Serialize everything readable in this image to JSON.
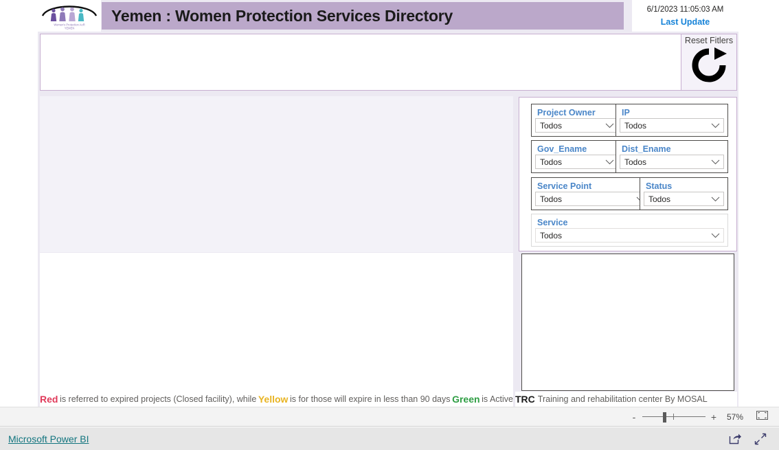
{
  "header": {
    "logo_alt": "Women's Protection AoR Yemen logo",
    "logo_caption_line1": "Women's Protection AoR",
    "logo_caption_line2": "YEMEN",
    "title": "Yemen : Women Protection Services Directory",
    "last_update_date": "6/1/2023 11:05:03 AM",
    "last_update_label": "Last Update",
    "title_bar_color": "#bba8ca",
    "last_update_color": "#1683d8"
  },
  "reset": {
    "label": "Reset Fitlers",
    "icon": "refresh-circular-arrow-icon"
  },
  "slicers": [
    {
      "id": "project-owner",
      "title": "Project Owner",
      "value": "Todos",
      "icon": "chevron-down-icon"
    },
    {
      "id": "ip",
      "title": "IP",
      "value": "Todos",
      "icon": "chevron-down-icon"
    },
    {
      "id": "gov-ename",
      "title": "Gov_Ename",
      "value": "Todos",
      "icon": "chevron-down-icon"
    },
    {
      "id": "dist-ename",
      "title": "Dist_Ename",
      "value": "Todos",
      "icon": "chevron-down-icon"
    },
    {
      "id": "service-point",
      "title": "Service Point",
      "value": "Todos",
      "icon": "chevron-down-icon"
    },
    {
      "id": "status",
      "title": "Status",
      "value": "Todos",
      "icon": "chevron-down-icon"
    },
    {
      "id": "service",
      "title": "Service",
      "value": "Todos",
      "icon": "chevron-down-icon"
    }
  ],
  "legend": {
    "red_word": "Red",
    "text_1": "is referred to expired projects (Closed facility), while",
    "yellow_word": "Yellow",
    "text_2": "is for those will expire in less than 90 days",
    "green_word": "Green",
    "text_3": "is Active",
    "red_color": "#e03a5a",
    "yellow_color": "#e8b423",
    "green_color": "#2f9e44",
    "trc_abbr": "TRC",
    "trc_text": "Training and rehabilitation center By MOSAL"
  },
  "status_bar": {
    "zoom_out_label": "-",
    "zoom_in_label": "+",
    "zoom_percent": "57%",
    "fit_icon": "fit-to-page-icon"
  },
  "footer": {
    "brand": "Microsoft Power BI",
    "brand_color": "#13757f",
    "share_icon": "share-icon",
    "fullscreen_icon": "fullscreen-arrows-icon"
  }
}
